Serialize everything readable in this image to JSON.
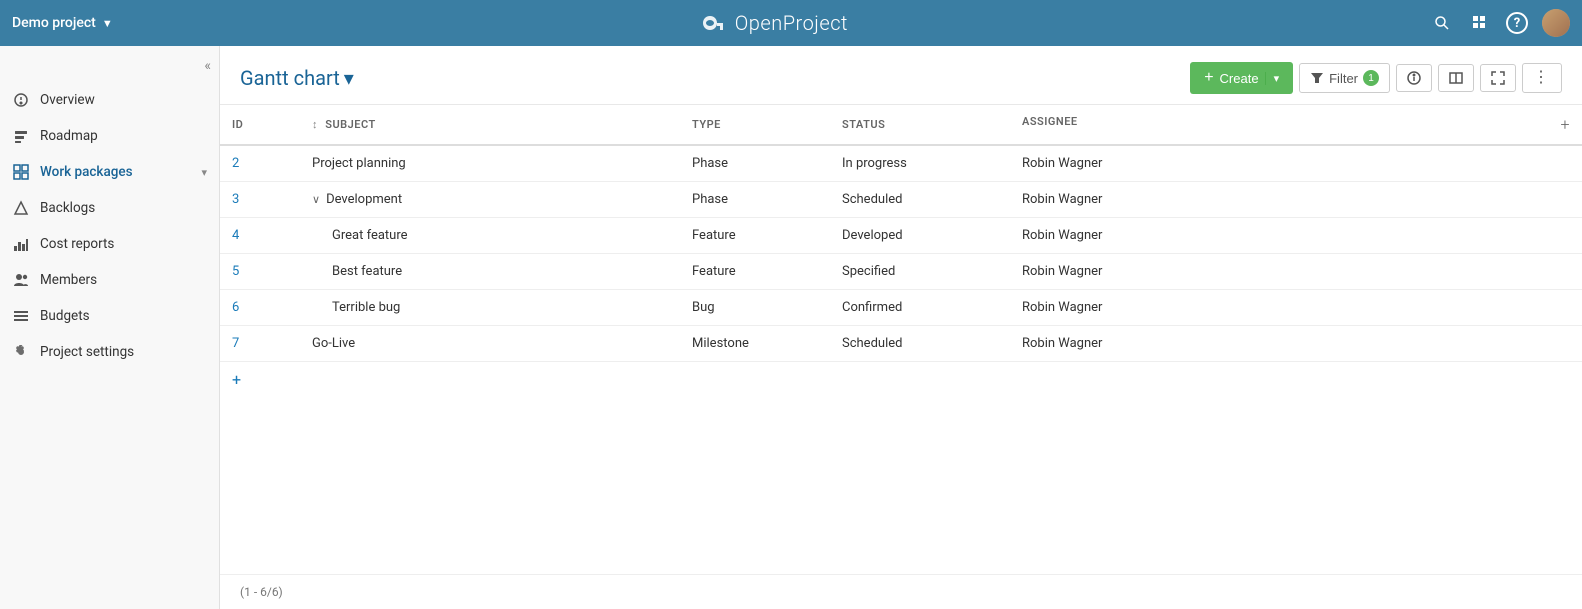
{
  "header": {
    "project_name": "Demo project",
    "project_chevron": "▼",
    "logo_text": "OpenProject",
    "icons": {
      "search": "🔍",
      "grid": "⊞",
      "help": "?",
      "avatar_alt": "User avatar"
    }
  },
  "sidebar": {
    "collapse_label": "«",
    "items": [
      {
        "id": "overview",
        "label": "Overview",
        "icon": "ℹ",
        "active": false
      },
      {
        "id": "roadmap",
        "label": "Roadmap",
        "icon": "◼",
        "active": false
      },
      {
        "id": "work-packages",
        "label": "Work packages",
        "icon": "⊞",
        "active": true,
        "has_chevron": true
      },
      {
        "id": "backlogs",
        "label": "Backlogs",
        "icon": "△",
        "active": false
      },
      {
        "id": "cost-reports",
        "label": "Cost reports",
        "icon": "📊",
        "active": false
      },
      {
        "id": "members",
        "label": "Members",
        "icon": "👥",
        "active": false
      },
      {
        "id": "budgets",
        "label": "Budgets",
        "icon": "≡",
        "active": false
      },
      {
        "id": "project-settings",
        "label": "Project settings",
        "icon": "⚙",
        "active": false
      }
    ]
  },
  "content": {
    "page_title": "Gantt chart",
    "title_dropdown": "▾",
    "toolbar": {
      "create_label": "Create",
      "filter_label": "Filter",
      "filter_count": "1"
    },
    "table": {
      "columns": [
        {
          "id": "id",
          "label": "ID"
        },
        {
          "id": "subject",
          "label": "Subject",
          "sort_icon": "↕"
        },
        {
          "id": "type",
          "label": "Type"
        },
        {
          "id": "status",
          "label": "Status"
        },
        {
          "id": "assignee",
          "label": "Assignee"
        }
      ],
      "rows": [
        {
          "id": "2",
          "subject": "Project planning",
          "indent": false,
          "expandable": false,
          "type": "Phase",
          "status": "In progress",
          "assignee": "Robin Wagner"
        },
        {
          "id": "3",
          "subject": "Development",
          "indent": false,
          "expandable": true,
          "type": "Phase",
          "status": "Scheduled",
          "assignee": "Robin Wagner"
        },
        {
          "id": "4",
          "subject": "Great feature",
          "indent": true,
          "expandable": false,
          "type": "Feature",
          "status": "Developed",
          "assignee": "Robin Wagner"
        },
        {
          "id": "5",
          "subject": "Best feature",
          "indent": true,
          "expandable": false,
          "type": "Feature",
          "status": "Specified",
          "assignee": "Robin Wagner"
        },
        {
          "id": "6",
          "subject": "Terrible bug",
          "indent": true,
          "expandable": false,
          "type": "Bug",
          "status": "Confirmed",
          "assignee": "Robin Wagner"
        },
        {
          "id": "7",
          "subject": "Go-Live",
          "indent": false,
          "expandable": false,
          "type": "Milestone",
          "status": "Scheduled",
          "assignee": "Robin Wagner"
        }
      ]
    },
    "pagination": "(1 - 6/6)"
  }
}
